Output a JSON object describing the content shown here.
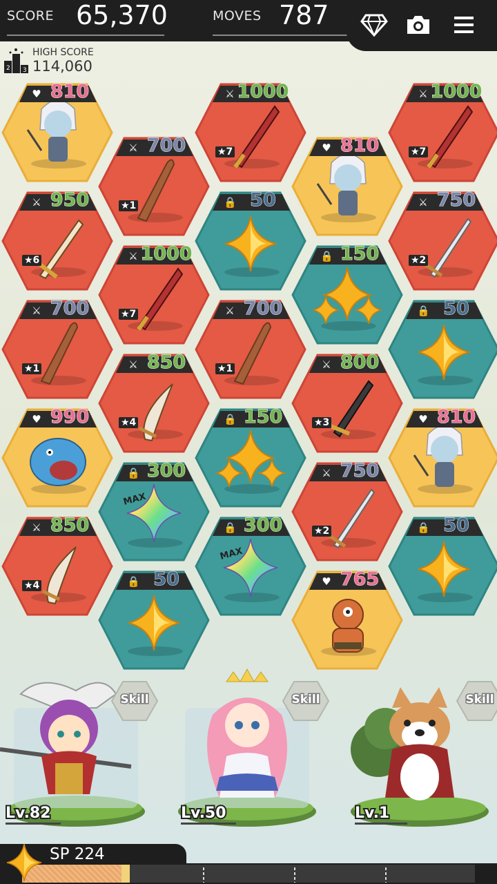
{
  "header": {
    "score_label": "SCORE",
    "score_value": "65,370",
    "moves_label": "MOVES",
    "moves_value": "787",
    "icons": [
      "diamond-icon",
      "camera-icon",
      "menu-icon"
    ]
  },
  "high_score": {
    "label": "HIGH SCORE",
    "value": "114,060",
    "icon": "podium-icon"
  },
  "colors": {
    "character_tile": "#f7c457",
    "weapon_tile": "#e45a45",
    "star_tile": "#3f9c9a",
    "hp_value": "#f07a9a",
    "atk_value": "#7bc05a",
    "lock_value": "#3d77a0"
  },
  "board": {
    "tiles": [
      {
        "kind": "character",
        "stat_icon": "heart-icon",
        "value": "810",
        "art": "elf-warrior",
        "value_color": "#e87090"
      },
      {
        "kind": "weapon",
        "stat_icon": "sword-icon",
        "value": "700",
        "rank": "★1",
        "art": "wooden-club",
        "value_color": "#7b86a8"
      },
      {
        "kind": "weapon",
        "stat_icon": "sword-icon",
        "value": "1000",
        "rank": "★7",
        "art": "crimson-blade",
        "value_color": "#74b551"
      },
      {
        "kind": "character",
        "stat_icon": "heart-icon",
        "value": "810",
        "art": "elf-warrior",
        "value_color": "#e87090"
      },
      {
        "kind": "weapon",
        "stat_icon": "sword-icon",
        "value": "1000",
        "rank": "★7",
        "art": "crimson-blade",
        "value_color": "#74b551"
      },
      {
        "kind": "weapon",
        "stat_icon": "sword-icon",
        "value": "950",
        "rank": "★6",
        "art": "ornate-sword",
        "value_color": "#74b551"
      },
      {
        "kind": "star",
        "stat_icon": "lock-icon",
        "value": "50",
        "art": "gold-star",
        "value_color": "#4a6d8c"
      },
      {
        "kind": "star",
        "stat_icon": "lock-icon",
        "value": "150",
        "art": "triple-star",
        "value_color": "#74b551"
      },
      {
        "kind": "weapon",
        "stat_icon": "sword-icon",
        "value": "750",
        "rank": "★2",
        "art": "steel-sword",
        "value_color": "#7b86a8"
      },
      {
        "kind": "weapon",
        "stat_icon": "sword-icon",
        "value": "1000",
        "rank": "★7",
        "art": "crimson-blade",
        "value_color": "#74b551"
      },
      {
        "kind": "weapon",
        "stat_icon": "sword-icon",
        "value": "700",
        "rank": "★1",
        "art": "wooden-club",
        "value_color": "#7b86a8"
      },
      {
        "kind": "weapon",
        "stat_icon": "sword-icon",
        "value": "700",
        "rank": "★1",
        "art": "wooden-club",
        "value_color": "#7b86a8"
      },
      {
        "kind": "star",
        "stat_icon": "lock-icon",
        "value": "50",
        "art": "gold-star",
        "value_color": "#4a6d8c"
      },
      {
        "kind": "weapon",
        "stat_icon": "sword-icon",
        "value": "850",
        "rank": "★4",
        "art": "curved-blade",
        "value_color": "#74b551"
      },
      {
        "kind": "weapon",
        "stat_icon": "sword-icon",
        "value": "800",
        "rank": "★3",
        "art": "dark-sword",
        "value_color": "#74b551"
      },
      {
        "kind": "character",
        "stat_icon": "heart-icon",
        "value": "990",
        "art": "blue-fish-monster",
        "value_color": "#e87090"
      },
      {
        "kind": "star",
        "stat_icon": "lock-icon",
        "value": "150",
        "art": "triple-star",
        "value_color": "#74b551"
      },
      {
        "kind": "character",
        "stat_icon": "heart-icon",
        "value": "810",
        "art": "elf-warrior",
        "value_color": "#e87090"
      },
      {
        "kind": "star",
        "stat_icon": "lock-icon",
        "value": "300",
        "art": "rainbow-star",
        "max": "MAX",
        "value_color": "#74b551"
      },
      {
        "kind": "weapon",
        "stat_icon": "sword-icon",
        "value": "750",
        "rank": "★2",
        "art": "steel-sword",
        "value_color": "#7b86a8"
      },
      {
        "kind": "weapon",
        "stat_icon": "sword-icon",
        "value": "850",
        "rank": "★4",
        "art": "curved-blade",
        "value_color": "#74b551"
      },
      {
        "kind": "star",
        "stat_icon": "lock-icon",
        "value": "300",
        "art": "rainbow-star",
        "max": "MAX",
        "value_color": "#74b551"
      },
      {
        "kind": "star",
        "stat_icon": "lock-icon",
        "value": "50",
        "art": "gold-star",
        "value_color": "#4a6d8c"
      },
      {
        "kind": "star",
        "stat_icon": "lock-icon",
        "value": "50",
        "art": "gold-star",
        "value_color": "#4a6d8c"
      },
      {
        "kind": "character",
        "stat_icon": "heart-icon",
        "value": "765",
        "art": "cyclops-brute",
        "value_color": "#e87090"
      }
    ]
  },
  "heroes": [
    {
      "name": "winged-helm-warrior",
      "skill_label": "Skill",
      "level": "Lv.82"
    },
    {
      "name": "pink-haired-princess",
      "skill_label": "Skill",
      "level": "Lv.50"
    },
    {
      "name": "shiba-dog",
      "skill_label": "Skill",
      "level": "Lv.1"
    }
  ],
  "sp": {
    "label": "SP 224",
    "gauge_fraction": 0.22,
    "segments": 4
  }
}
